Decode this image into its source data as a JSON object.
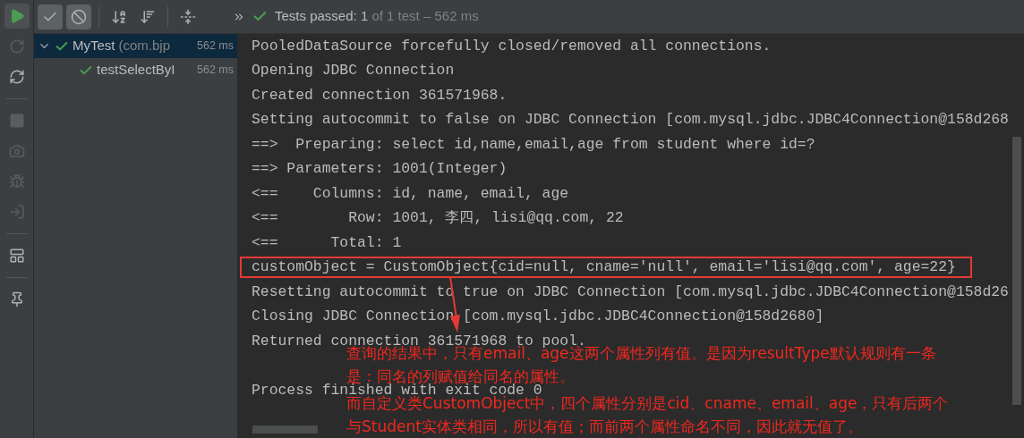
{
  "toolbar": {
    "buttons": [
      {
        "kind": "check",
        "selected": true
      },
      {
        "kind": "stop",
        "selected": true
      },
      {
        "kind": "sort-alpha",
        "selected": false
      },
      {
        "kind": "sort-duration",
        "selected": false
      },
      {
        "kind": "expand",
        "selected": false
      }
    ],
    "status": {
      "label": "Tests passed:",
      "count": "1",
      "detail": "of 1 test – 562 ms"
    }
  },
  "side_toolbar": [
    {
      "kind": "run",
      "disabled": false
    },
    {
      "kind": "rerun",
      "disabled": true
    },
    {
      "kind": "toggle",
      "disabled": false
    },
    {
      "kind": "stop",
      "disabled": true
    },
    {
      "kind": "camera",
      "disabled": true
    },
    {
      "kind": "bug",
      "disabled": true
    },
    {
      "kind": "import",
      "disabled": true
    },
    {
      "kind": "layout",
      "disabled": false
    },
    {
      "kind": "pin",
      "disabled": false
    }
  ],
  "tree": [
    {
      "name": "MyTest",
      "detail": "(com.bjp",
      "time": "562 ms",
      "passed": true,
      "expanded": true,
      "selected": true,
      "children": [
        {
          "name": "testSelectByI",
          "time": "562 ms",
          "passed": true,
          "selected": false
        }
      ]
    }
  ],
  "console": {
    "lines": [
      {
        "text": "PooledDataSource forcefully closed/removed all connections.",
        "highlighted": false
      },
      {
        "text": "Opening JDBC Connection",
        "highlighted": false
      },
      {
        "text": "Created connection 361571968.",
        "highlighted": false
      },
      {
        "text": "Setting autocommit to false on JDBC Connection [com.mysql.jdbc.JDBC4Connection@158d268",
        "highlighted": false
      },
      {
        "text": "==>  Preparing: select id,name,email,age from student where id=?",
        "highlighted": false
      },
      {
        "text": "==> Parameters: 1001(Integer)",
        "highlighted": false
      },
      {
        "text": "<==    Columns: id, name, email, age",
        "highlighted": false
      },
      {
        "text": "<==        Row: 1001, 李四, lisi@qq.com, 22",
        "highlighted": false
      },
      {
        "text": "<==      Total: 1",
        "highlighted": false
      },
      {
        "text": "customObject = CustomObject{cid=null, cname='null', email='lisi@qq.com', age=22}",
        "highlighted": true
      },
      {
        "text": "Resetting autocommit to true on JDBC Connection [com.mysql.jdbc.JDBC4Connection@158d26",
        "highlighted": false
      },
      {
        "text": "Closing JDBC Connection [com.mysql.jdbc.JDBC4Connection@158d2680]",
        "highlighted": false
      },
      {
        "text": "Returned connection 361571968 to pool.",
        "highlighted": false
      },
      {
        "text": "Process finished with exit code 0",
        "highlighted": false,
        "gap_before": true
      }
    ]
  },
  "annotation": {
    "lines": [
      "查询的结果中，只有email、age这两个属性列有值。是因为resultType默认规则有一条",
      "是：同名的列赋值给同名的属性。",
      "而自定义类CustomObject中，四个属性分别是cid、cname、email、age，只有后两个",
      "与Student实体类相同，所以有值；而前两个属性命名不同，因此就无值了。"
    ]
  }
}
